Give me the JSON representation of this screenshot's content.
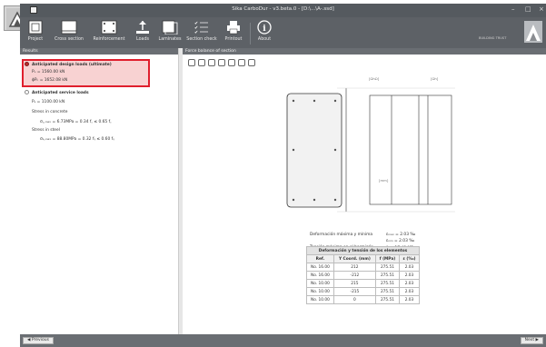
{
  "window": {
    "title": "Sika CarboDur - v3.beta.0 - [D:\\...\\A-.ssd]",
    "controls": [
      "–",
      "□",
      "×"
    ]
  },
  "ribbon": {
    "buttons": [
      {
        "label": "Project",
        "icon": "project-icon"
      },
      {
        "label": "Cross section",
        "icon": "cross-section-icon"
      },
      {
        "label": "Reinforcement",
        "icon": "reinforcement-icon"
      },
      {
        "label": "Loads",
        "icon": "loads-icon"
      },
      {
        "label": "Laminates",
        "icon": "laminates-icon"
      },
      {
        "label": "Section check",
        "icon": "section-check-icon"
      },
      {
        "label": "Printout",
        "icon": "printer-icon"
      },
      {
        "label": "About",
        "icon": "info-icon"
      }
    ],
    "site_info": "BUILDING TRUST"
  },
  "left_panel": {
    "header": "Results",
    "ultimate": {
      "label": "Anticipated design loads (ultimate)",
      "line1": "Pᵤ   = 1560.00  kN",
      "line2": "ϕPₙ  = 1652.08  kN"
    },
    "service": {
      "label": "Anticipated service loads",
      "line1": "Pₛ   = 1100.00  kN",
      "concrete_title": "Stress in concrete",
      "concrete_value": "σ꜀,ₘₐₓ = 6.73MPa = 0.34 f꜀ ≤ 0.65 f꜀",
      "steel_title": "Stress in steel",
      "steel_value": "σₛ,ₘₐₓ = 88.80MPa = 0.32 fᵧ ≤ 0.60 fᵧ"
    }
  },
  "right_panel": {
    "header": "Force balance of section",
    "dim_top_1": "[ΩhΩ]",
    "dim_top_2": "[Ωh]",
    "dim_bottom": "[mm]",
    "eq1_label": "Deformación máxima y mínima",
    "eq1_val": "εₘₐₓ = 2.03 ‰",
    "eq2_val": "εₘᵢₙ = 2.03 ‰",
    "eq3_label": "Tensión máxima en el hormigón",
    "eq3_val": "f꜀ = 17.48 MPa",
    "table": {
      "caption": "Deformación y tensión de los elementos",
      "headers": [
        "Ref.",
        "Y Coord. (mm)",
        "f (MPa)",
        "ε (‰)"
      ],
      "rows": [
        [
          "No. 16.00",
          "212",
          "275.51",
          "2.03"
        ],
        [
          "No. 16.00",
          "-212",
          "275.51",
          "2.03"
        ],
        [
          "No. 10.00",
          "215",
          "275.51",
          "2.03"
        ],
        [
          "No. 10.00",
          "-215",
          "275.51",
          "2.03"
        ],
        [
          "No. 10.00",
          "0",
          "275.51",
          "2.03"
        ]
      ]
    }
  },
  "bottom": {
    "previous": "Previous",
    "next": "Next"
  },
  "colors": {
    "ribbon": "#5d6166",
    "highlight": "#e01f2d",
    "selected_radio": "#c12b2b"
  }
}
